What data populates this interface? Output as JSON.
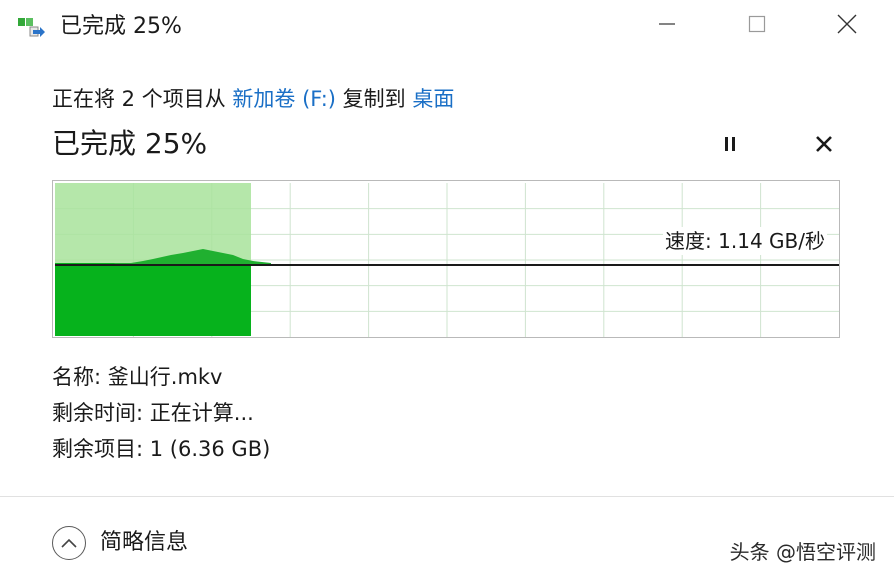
{
  "window": {
    "title": "已完成 25%",
    "icon": "file-copy-icon",
    "minimize_icon": "minimize-icon",
    "maximize_icon": "maximize-icon",
    "close_icon": "close-icon"
  },
  "header": {
    "prefix": "正在将 2 个项目从 ",
    "source": "新加卷 (F:)",
    "middle": " 复制到 ",
    "destination": "桌面"
  },
  "status": {
    "percent_text": "已完成 25%",
    "progress": 0.25,
    "pause_icon": "pause-icon",
    "cancel_icon": "cancel-icon"
  },
  "graph": {
    "speed_text": "速度: 1.14 GB/秒",
    "colors": {
      "progress_light": "#a8e39b",
      "progress_dark": "#06b21c",
      "speed_fill": "#20b030",
      "grid": "#cfe4cf",
      "speed_line": "#1a1a1a"
    }
  },
  "details": {
    "name_label": "名称: ",
    "name_value": "釜山行.mkv",
    "time_label": "剩余时间: ",
    "time_value": "正在计算...",
    "items_label": "剩余项目: ",
    "items_value": "1 (6.36 GB)"
  },
  "footer": {
    "less_details": "简略信息",
    "less_icon": "chevron-up-icon"
  },
  "watermark": {
    "text": "头条 @悟空评测"
  }
}
